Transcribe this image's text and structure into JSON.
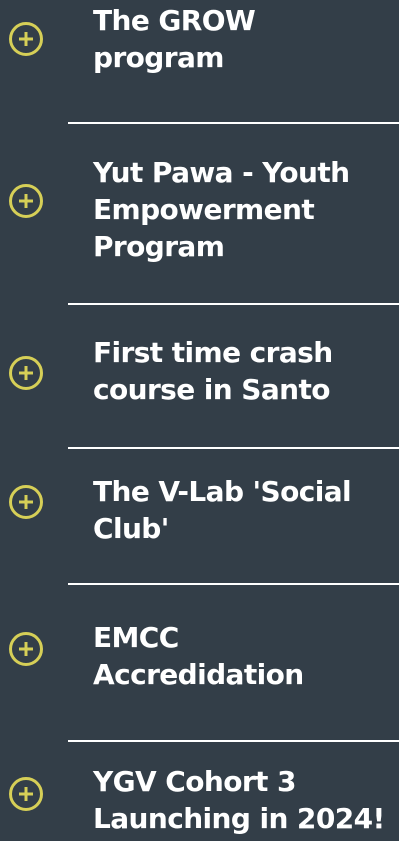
{
  "accordion": {
    "accent_color": "#d6cf57",
    "background_color": "#333e48",
    "toggle_icon": "plus-circle-icon",
    "items": [
      {
        "title": "The GROW program"
      },
      {
        "title": "Yut Pawa - Youth Empowerment Program"
      },
      {
        "title": "First time crash course in Santo"
      },
      {
        "title": "The V-Lab 'Social Club'"
      },
      {
        "title": "EMCC Accredidation"
      },
      {
        "title": "YGV Cohort 3 Launching in 2024!"
      }
    ]
  }
}
